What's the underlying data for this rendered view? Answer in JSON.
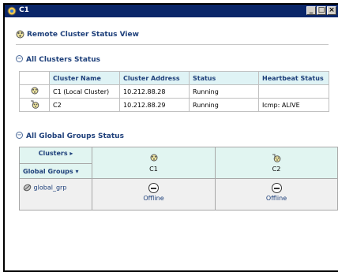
{
  "window": {
    "title": "C1"
  },
  "view": {
    "title": "Remote Cluster Status View"
  },
  "clusters_section": {
    "heading": "All Clusters Status",
    "columns": [
      "Cluster Name",
      "Cluster Address",
      "Status",
      "Heartbeat Status"
    ],
    "rows": [
      {
        "name": "C1 (Local Cluster)",
        "address": "10.212.88.28",
        "status": "Running",
        "heartbeat": ""
      },
      {
        "name": "C2",
        "address": "10.212.88.29",
        "status": "Running",
        "heartbeat": "Icmp: ALIVE"
      }
    ]
  },
  "groups_section": {
    "heading": "All Global Groups Status",
    "clusters_label": "Clusters",
    "groups_label": "Global Groups",
    "cluster_columns": [
      "C1",
      "C2"
    ],
    "groups": [
      {
        "name": "global_grp",
        "states": [
          "Offline",
          "Offline"
        ]
      }
    ]
  },
  "colors": {
    "titlebar": "#0a2669",
    "heading": "#1d3f7a",
    "header_bg": "#dff3f5"
  },
  "icons": [
    "cluster-icon",
    "remote-cluster-icon",
    "expand-circle-icon",
    "offline-icon",
    "service-group-icon"
  ]
}
